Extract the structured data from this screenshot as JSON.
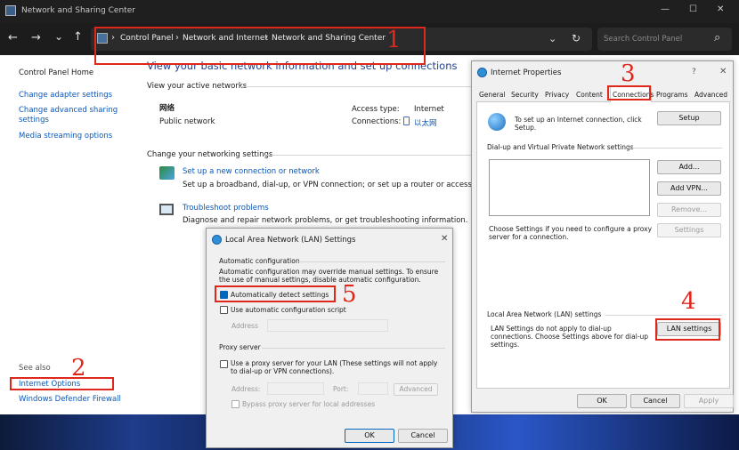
{
  "titlebar": {
    "title": "Network and Sharing Center",
    "min": "—",
    "max": "☐",
    "close": "✕"
  },
  "nav": {
    "back": "←",
    "forward": "→",
    "history": "⌄",
    "up": "↑",
    "chev": "›",
    "crumbs": [
      "Control Panel",
      "Network and Internet",
      "Network and Sharing Center"
    ],
    "dropdown": "⌄",
    "refresh": "↻",
    "search_placeholder": "Search Control Panel",
    "search_icon": "⌕"
  },
  "sidebar": {
    "home": "Control Panel Home",
    "links": [
      "Change adapter settings",
      "Change advanced sharing settings",
      "Media streaming options"
    ],
    "see_also": "See also",
    "see_also_links": [
      "Internet Options",
      "Windows Defender Firewall"
    ]
  },
  "main": {
    "title": "View your basic network information and set up connections",
    "active_header": "View your active networks",
    "net_name": "网络",
    "net_type": "Public network",
    "access_label": "Access type:",
    "access_value": "Internet",
    "conn_label": "Connections:",
    "conn_value": "以太网",
    "change_header": "Change your networking settings",
    "item1_title": "Set up a new connection or network",
    "item1_desc": "Set up a broadband, dial-up, or VPN connection; or set up a router or access point.",
    "item2_title": "Troubleshoot problems",
    "item2_desc": "Diagnose and repair network problems, or get troubleshooting information."
  },
  "inet": {
    "title": "Internet Properties",
    "help": "?",
    "close": "✕",
    "tabs": [
      "General",
      "Security",
      "Privacy",
      "Content",
      "Connections",
      "Programs",
      "Advanced"
    ],
    "setup_text": "To set up an Internet connection, click Setup.",
    "setup_btn": "Setup",
    "dialup_header": "Dial-up and Virtual Private Network settings",
    "add_btn": "Add...",
    "addvpn_btn": "Add VPN...",
    "remove_btn": "Remove...",
    "choose_text": "Choose Settings if you need to configure a proxy server for a connection.",
    "settings_btn": "Settings",
    "lan_header": "Local Area Network (LAN) settings",
    "lan_text": "LAN Settings do not apply to dial-up connections. Choose Settings above for dial-up settings.",
    "lan_btn": "LAN settings",
    "ok": "OK",
    "cancel": "Cancel",
    "apply": "Apply"
  },
  "lan": {
    "title": "Local Area Network (LAN) Settings",
    "close": "✕",
    "auto_header": "Automatic configuration",
    "auto_desc": "Automatic configuration may override manual settings.  To ensure the use of manual settings, disable automatic configuration.",
    "detect": "Automatically detect settings",
    "script": "Use automatic configuration script",
    "address": "Address",
    "proxy_header": "Proxy server",
    "proxy_use": "Use a proxy server for your LAN (These settings will not apply to dial-up or VPN connections).",
    "p_address": "Address:",
    "p_port": "Port:",
    "advanced": "Advanced",
    "bypass": "Bypass proxy server for local addresses",
    "ok": "OK",
    "cancel": "Cancel"
  },
  "annotations": [
    "1",
    "2",
    "3",
    "4",
    "5"
  ],
  "colors": {
    "titlebar": "#1f1f1f",
    "accent": "#0067c0",
    "annotation": "#e0271b",
    "link": "#0b57b8"
  }
}
